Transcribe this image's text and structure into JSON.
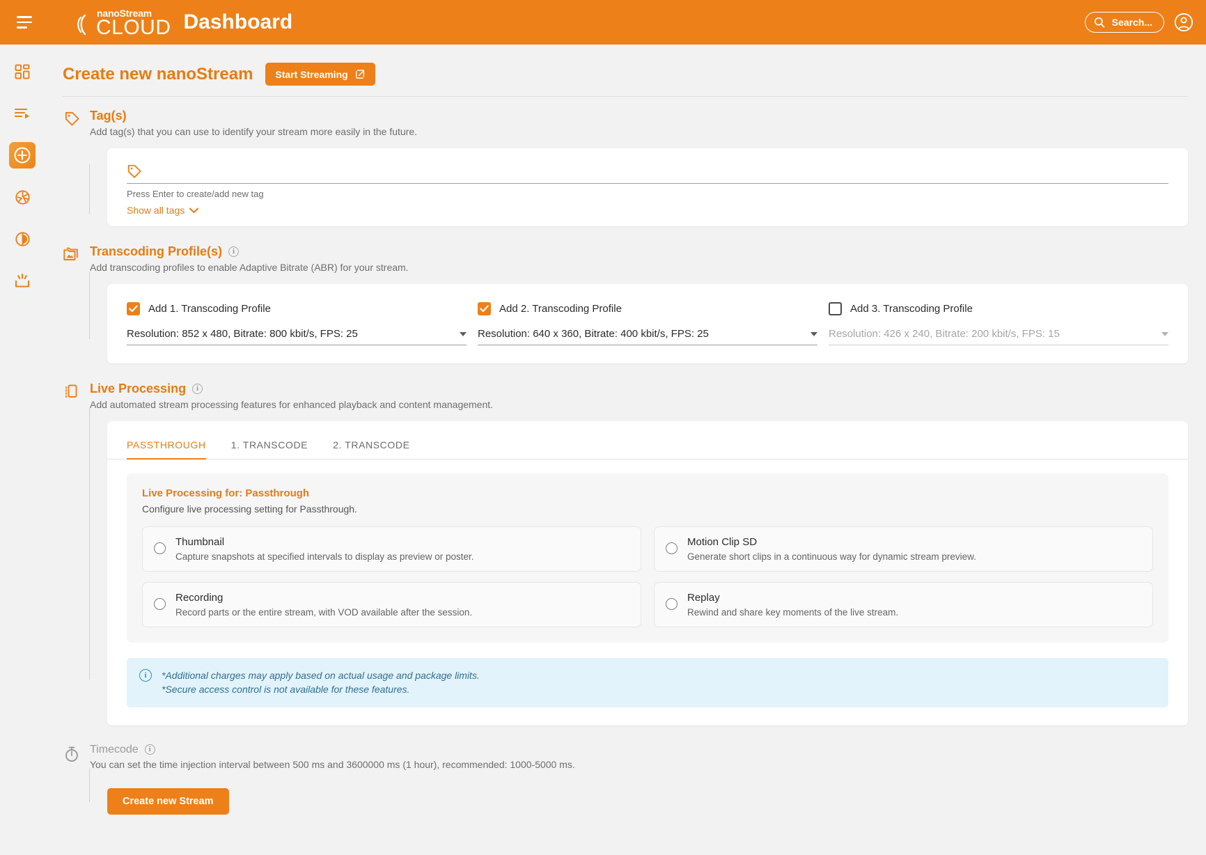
{
  "topbar": {
    "menu_icon": "hamburger-icon",
    "logo_nano": "nanoStream",
    "logo_cloud": "CLOUD",
    "app_title": "Dashboard",
    "search_label": "Search...",
    "search_icon": "search-icon",
    "account_icon": "account-circle-icon"
  },
  "sidebar": {
    "items": [
      {
        "name": "dashboard",
        "icon": "grid-dashboard-icon",
        "active": false
      },
      {
        "name": "streams",
        "icon": "list-play-icon",
        "active": false
      },
      {
        "name": "create-stream",
        "icon": "plus-circle-icon",
        "active": true
      },
      {
        "name": "webcaster",
        "icon": "aperture-icon",
        "active": false
      },
      {
        "name": "analytics",
        "icon": "pie-chart-icon",
        "active": false
      },
      {
        "name": "publish",
        "icon": "upload-tray-icon",
        "active": false
      }
    ]
  },
  "page": {
    "title": "Create new nanoStream",
    "start_button": "Start Streaming",
    "start_button_icon": "external-link-icon"
  },
  "tags_section": {
    "icon": "tag-icon",
    "title": "Tag(s)",
    "subtitle": "Add tag(s) that you can use to identify your stream more easily in the future.",
    "input_value": "",
    "input_placeholder": "",
    "field_icon": "tag-icon",
    "hint": "Press Enter to create/add new tag",
    "show_all": "Show all tags",
    "show_all_icon": "chevron-down-icon"
  },
  "transcoding_section": {
    "icon": "image-folder-icon",
    "title": "Transcoding Profile(s)",
    "info_icon": "info-icon",
    "subtitle": "Add transcoding profiles to enable Adaptive Bitrate (ABR) for your stream.",
    "profiles": [
      {
        "label": "Add 1. Transcoding Profile",
        "checked": true,
        "enabled": true,
        "value": "Resolution: 852 x 480, Bitrate: 800 kbit/s, FPS: 25"
      },
      {
        "label": "Add 2. Transcoding Profile",
        "checked": true,
        "enabled": true,
        "value": "Resolution: 640 x 360, Bitrate: 400 kbit/s, FPS: 25"
      },
      {
        "label": "Add 3. Transcoding Profile",
        "checked": false,
        "enabled": false,
        "value": "Resolution: 426 x 240, Bitrate: 200 kbit/s, FPS: 15"
      }
    ]
  },
  "live_processing_section": {
    "icon": "live-processing-icon",
    "title": "Live Processing",
    "info_icon": "info-icon",
    "subtitle": "Add automated stream processing features for enhanced playback and content management.",
    "tabs": [
      {
        "label": "PASSTHROUGH",
        "active": true
      },
      {
        "label": "1. TRANSCODE",
        "active": false
      },
      {
        "label": "2. TRANSCODE",
        "active": false
      }
    ],
    "panel_title": "Live Processing for: Passthrough",
    "panel_subtitle": "Configure live processing setting for Passthrough.",
    "options": [
      {
        "name": "Thumbnail",
        "description": "Capture snapshots at specified intervals to display as preview or poster.",
        "selected": false
      },
      {
        "name": "Motion Clip SD",
        "description": "Generate short clips in a continuous way for dynamic stream preview.",
        "selected": false
      },
      {
        "name": "Recording",
        "description": "Record parts or the entire stream, with VOD available after the session.",
        "selected": false
      },
      {
        "name": "Replay",
        "description": "Rewind and share key moments of the live stream.",
        "selected": false
      }
    ],
    "notice_icon": "info-icon",
    "notice_lines": [
      "*Additional charges may apply based on actual usage and package limits.",
      "*Secure access control is not available for these features."
    ]
  },
  "timecode_section": {
    "icon": "stopwatch-icon",
    "title": "Timecode",
    "info_icon": "info-icon",
    "subtitle": "You can set the time injection interval between 500 ms and 3600000 ms (1 hour), recommended: 1000-5000 ms."
  },
  "footer": {
    "create_button": "Create new Stream"
  },
  "colors": {
    "brand_orange": "#ed8018",
    "title_orange": "#e87b10",
    "page_bg": "#f2f2f2",
    "card_bg": "#ffffff",
    "notice_bg": "#e3f3fb",
    "notice_text": "#2e6f8e"
  }
}
